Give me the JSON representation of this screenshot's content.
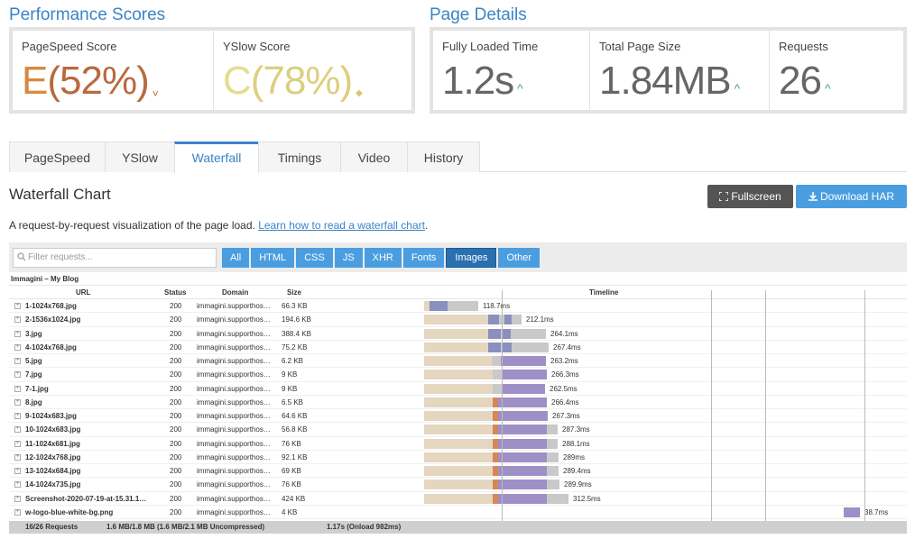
{
  "performance": {
    "title": "Performance Scores",
    "pagespeed_label": "PageSpeed Score",
    "pagespeed_grade": "E",
    "pagespeed_pct": "(52%)",
    "pagespeed_arrow": "˅",
    "yslow_label": "YSlow Score",
    "yslow_grade": "C",
    "yslow_pct": "(78%)",
    "yslow_arrow": "◆"
  },
  "details": {
    "title": "Page Details",
    "loaded_label": "Fully Loaded Time",
    "loaded_value": "1.2s",
    "size_label": "Total Page Size",
    "size_value": "1.84MB",
    "requests_label": "Requests",
    "requests_value": "26",
    "arrow": "^"
  },
  "colors": {
    "accent": "#3a84c6",
    "grade_e": "#c0703a",
    "grade_c": "#e3d68a",
    "up_green": "#48a868"
  },
  "tabs": [
    "PageSpeed",
    "YSlow",
    "Waterfall",
    "Timings",
    "Video",
    "History"
  ],
  "waterfall": {
    "title": "Waterfall Chart",
    "fullscreen_label": "Fullscreen",
    "download_label": "Download HAR",
    "description": "A request-by-request visualization of the page load.",
    "learn_link": "Learn how to read a waterfall chart",
    "learn_suffix": ".",
    "filter_placeholder": "Filter requests...",
    "filters": [
      "All",
      "HTML",
      "CSS",
      "JS",
      "XHR",
      "Fonts",
      "Images",
      "Other"
    ],
    "active_filter": "Images",
    "page_name": "Immagini – My Blog",
    "columns": {
      "url": "URL",
      "status": "Status",
      "domain": "Domain",
      "size": "Size",
      "timeline": "Timeline"
    },
    "rows": [
      {
        "url": "1-1024x768.jpg",
        "status": "200",
        "domain": "immagini.supporthos…",
        "size": "66.3 KB",
        "time": "118.7ms"
      },
      {
        "url": "2-1536x1024.jpg",
        "status": "200",
        "domain": "immagini.supporthos…",
        "size": "194.6 KB",
        "time": "212.1ms"
      },
      {
        "url": "3.jpg",
        "status": "200",
        "domain": "immagini.supporthos…",
        "size": "388.4 KB",
        "time": "264.1ms"
      },
      {
        "url": "4-1024x768.jpg",
        "status": "200",
        "domain": "immagini.supporthos…",
        "size": "75.2 KB",
        "time": "267.4ms"
      },
      {
        "url": "5.jpg",
        "status": "200",
        "domain": "immagini.supporthos…",
        "size": "6.2 KB",
        "time": "263.2ms"
      },
      {
        "url": "7.jpg",
        "status": "200",
        "domain": "immagini.supporthos…",
        "size": "9 KB",
        "time": "266.3ms"
      },
      {
        "url": "7-1.jpg",
        "status": "200",
        "domain": "immagini.supporthos…",
        "size": "9 KB",
        "time": "262.5ms"
      },
      {
        "url": "8.jpg",
        "status": "200",
        "domain": "immagini.supporthos…",
        "size": "6.5 KB",
        "time": "266.4ms"
      },
      {
        "url": "9-1024x683.jpg",
        "status": "200",
        "domain": "immagini.supporthos…",
        "size": "64.6 KB",
        "time": "267.3ms"
      },
      {
        "url": "10-1024x683.jpg",
        "status": "200",
        "domain": "immagini.supporthos…",
        "size": "56.8 KB",
        "time": "287.3ms"
      },
      {
        "url": "11-1024x681.jpg",
        "status": "200",
        "domain": "immagini.supporthos…",
        "size": "76 KB",
        "time": "288.1ms"
      },
      {
        "url": "12-1024x768.jpg",
        "status": "200",
        "domain": "immagini.supporthos…",
        "size": "92.1 KB",
        "time": "289ms"
      },
      {
        "url": "13-1024x684.jpg",
        "status": "200",
        "domain": "immagini.supporthos…",
        "size": "69 KB",
        "time": "289.4ms"
      },
      {
        "url": "14-1024x735.jpg",
        "status": "200",
        "domain": "immagini.supporthos…",
        "size": "76 KB",
        "time": "289.9ms"
      },
      {
        "url": "Screenshot-2020-07-19-at-15.31.1…",
        "status": "200",
        "domain": "immagini.supporthos…",
        "size": "424 KB",
        "time": "312.5ms"
      },
      {
        "url": "w-logo-blue-white-bg.png",
        "status": "200",
        "domain": "immagini.supporthos…",
        "size": "4 KB",
        "time": "38.7ms"
      }
    ],
    "footer": {
      "requests": "16/26 Requests",
      "size": "1.6 MB/1.8 MB  (1.6 MB/2.1 MB Uncompressed)",
      "time": "1.17s  (Onload 982ms)"
    }
  }
}
